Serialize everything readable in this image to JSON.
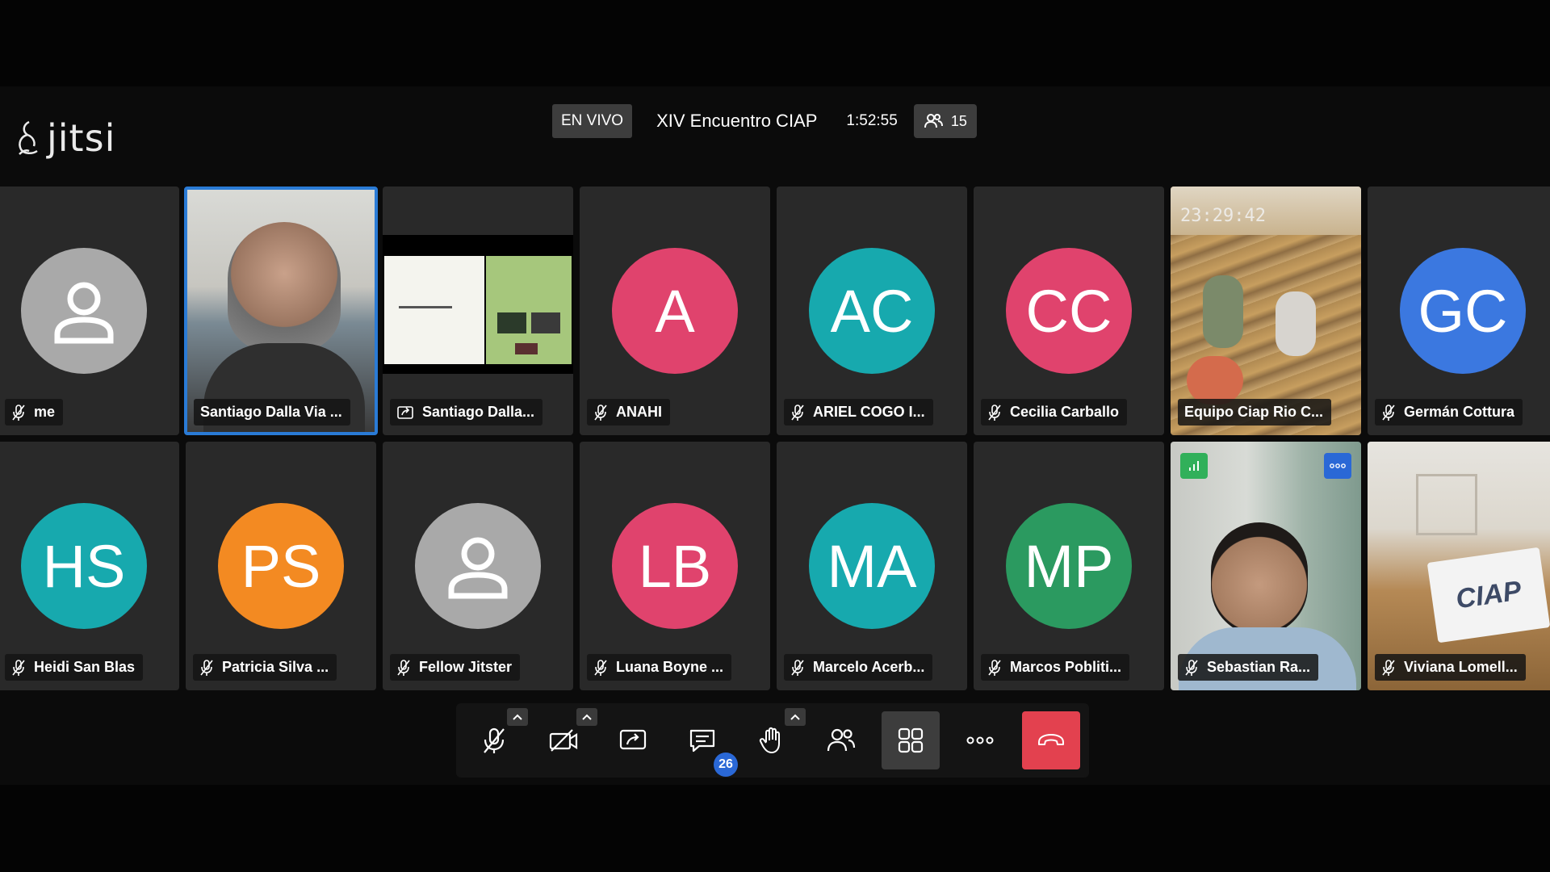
{
  "app": {
    "logo_text": "jitsi"
  },
  "header": {
    "live_label": "EN VIVO",
    "meeting_title": "XIV Encuentro CIAP",
    "elapsed_time": "1:52:55",
    "participant_count": "15"
  },
  "colors": {
    "tile_bg": "#292929",
    "active_border": "#2a7bd6",
    "hangup": "#e3414f",
    "badge_blue": "#2a68d6"
  },
  "tiles_row1": [
    {
      "name": "me",
      "initials": "",
      "avatar_color": "#a9a9a9",
      "type": "default-avatar"
    },
    {
      "name": "Santiago Dalla Via ...",
      "type": "video",
      "active": true
    },
    {
      "name": "Santiago Dalla...",
      "type": "screenshare"
    },
    {
      "name": "ANAHI",
      "initials": "A",
      "avatar_color": "#e0436d",
      "type": "initials"
    },
    {
      "name": "ARIEL COGO I...",
      "initials": "AC",
      "avatar_color": "#17a9ae",
      "type": "initials"
    },
    {
      "name": "Cecilia Carballo",
      "initials": "CC",
      "avatar_color": "#e0436d",
      "type": "initials"
    },
    {
      "name": "Equipo Ciap Rio C...",
      "type": "video",
      "overlay_time": "23:29:42"
    },
    {
      "name": "Germán Cottura",
      "initials": "GC",
      "avatar_color": "#3b78e0",
      "type": "initials"
    }
  ],
  "tiles_row2": [
    {
      "name": "Heidi San Blas",
      "initials": "HS",
      "avatar_color": "#17a9ae",
      "type": "initials"
    },
    {
      "name": "Patricia Silva ...",
      "initials": "PS",
      "avatar_color": "#f38a22",
      "type": "initials"
    },
    {
      "name": "Fellow Jitster",
      "initials": "",
      "avatar_color": "#a9a9a9",
      "type": "default-avatar"
    },
    {
      "name": "Luana Boyne ...",
      "initials": "LB",
      "avatar_color": "#e0436d",
      "type": "initials"
    },
    {
      "name": "Marcelo Acerb...",
      "initials": "MA",
      "avatar_color": "#17a9ae",
      "type": "initials"
    },
    {
      "name": "Marcos Pobliti...",
      "initials": "MP",
      "avatar_color": "#2b9a60",
      "type": "initials"
    },
    {
      "name": "Sebastian Ra...",
      "type": "video"
    },
    {
      "name": "Viviana Lomell...",
      "type": "video",
      "sign_text": "CIAP"
    }
  ],
  "toolbar": {
    "chat_unread": "26",
    "buttons": [
      "microphone-icon",
      "camera-icon",
      "share-screen-icon",
      "chat-icon",
      "raise-hand-icon",
      "participants-icon",
      "tile-view-icon",
      "more-icon",
      "hangup-icon"
    ]
  }
}
